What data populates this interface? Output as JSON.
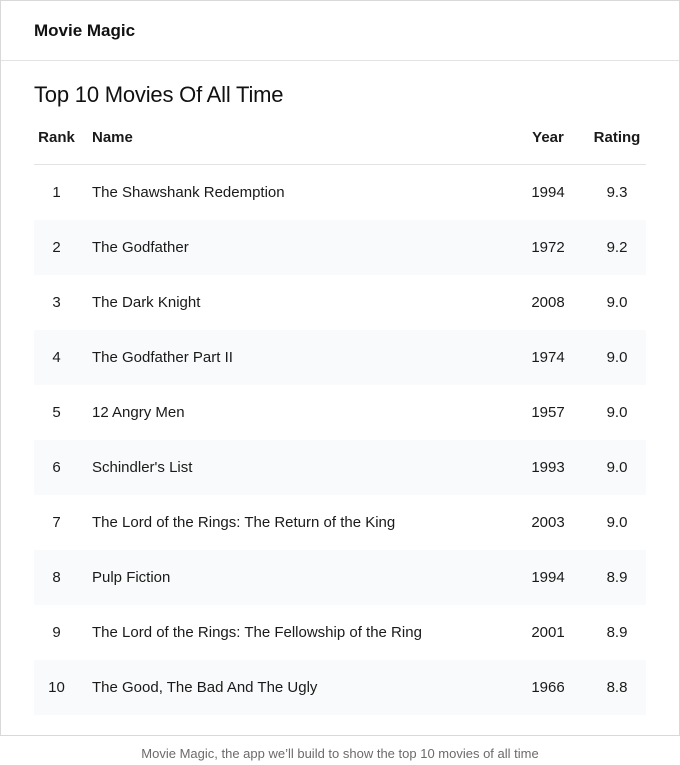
{
  "app": {
    "name": "Movie Magic"
  },
  "page": {
    "title": "Top 10 Movies Of All Time"
  },
  "table": {
    "headers": {
      "rank": "Rank",
      "name": "Name",
      "year": "Year",
      "rating": "Rating"
    },
    "rows": [
      {
        "rank": "1",
        "name": "The Shawshank Redemption",
        "year": "1994",
        "rating": "9.3"
      },
      {
        "rank": "2",
        "name": "The Godfather",
        "year": "1972",
        "rating": "9.2"
      },
      {
        "rank": "3",
        "name": "The Dark Knight",
        "year": "2008",
        "rating": "9.0"
      },
      {
        "rank": "4",
        "name": "The Godfather Part II",
        "year": "1974",
        "rating": "9.0"
      },
      {
        "rank": "5",
        "name": "12 Angry Men",
        "year": "1957",
        "rating": "9.0"
      },
      {
        "rank": "6",
        "name": "Schindler's List",
        "year": "1993",
        "rating": "9.0"
      },
      {
        "rank": "7",
        "name": "The Lord of the Rings: The Return of the King",
        "year": "2003",
        "rating": "9.0"
      },
      {
        "rank": "8",
        "name": "Pulp Fiction",
        "year": "1994",
        "rating": "8.9"
      },
      {
        "rank": "9",
        "name": "The Lord of the Rings: The Fellowship of the Ring",
        "year": "2001",
        "rating": "8.9"
      },
      {
        "rank": "10",
        "name": "The Good, The Bad And The Ugly",
        "year": "1966",
        "rating": "8.8"
      }
    ]
  },
  "caption": "Movie Magic, the app we’ll build to show the top 10 movies of all time",
  "colors": {
    "border": "#d9d9d9",
    "row_stripe": "#f9fafb",
    "text": "#111111",
    "caption": "#6b6b6b"
  }
}
